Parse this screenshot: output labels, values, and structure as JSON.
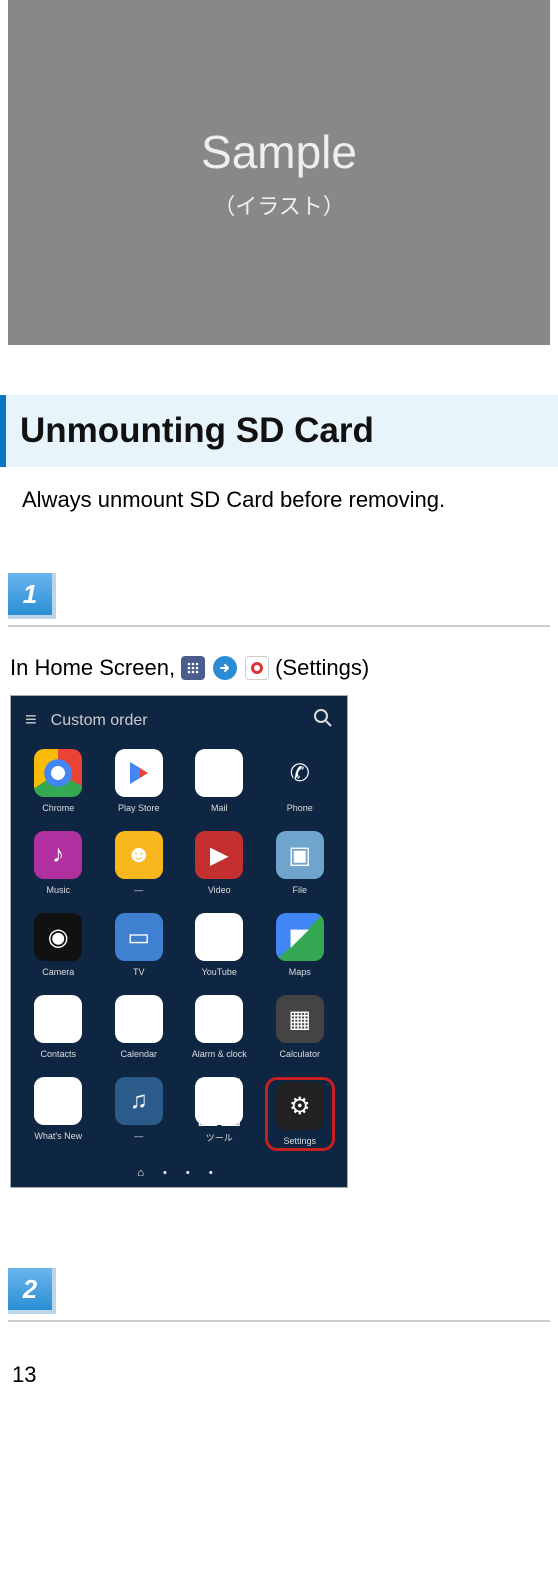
{
  "sample": {
    "title": "Sample",
    "subtitle": "（イラスト）"
  },
  "section": {
    "title": "Unmounting SD Card",
    "intro": "Always unmount SD Card before removing."
  },
  "steps": {
    "step1": {
      "num": "1",
      "text_prefix": "In Home Screen,",
      "text_suffix": "(Settings)"
    },
    "step2": {
      "num": "2"
    }
  },
  "phone": {
    "topbar_title": "Custom order",
    "apps": [
      {
        "label": "Chrome"
      },
      {
        "label": "Play Store"
      },
      {
        "label": "Mail"
      },
      {
        "label": "Phone"
      },
      {
        "label": "Music"
      },
      {
        "label": "—"
      },
      {
        "label": "Video"
      },
      {
        "label": "File"
      },
      {
        "label": "Camera"
      },
      {
        "label": "TV"
      },
      {
        "label": "YouTube"
      },
      {
        "label": "Maps"
      },
      {
        "label": "Contacts"
      },
      {
        "label": "Calendar"
      },
      {
        "label": "Alarm & clock"
      },
      {
        "label": "Calculator"
      },
      {
        "label": "What's New"
      },
      {
        "label": "—"
      },
      {
        "label": "ツール"
      },
      {
        "label": "Settings"
      }
    ]
  },
  "page_number": "13"
}
